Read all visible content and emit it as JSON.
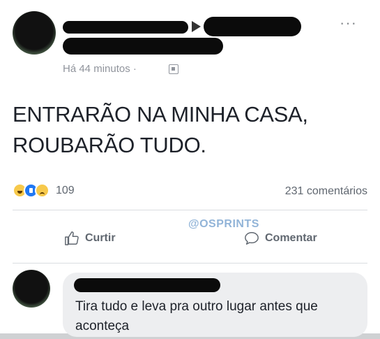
{
  "post": {
    "timestamp": "Há 44 minutos ·",
    "privacy_icon": "group-icon",
    "body": "ENTRARÃO NA MINHA CASA,\nROUBARÃO TUDO.",
    "more_icon": "more-dots-icon",
    "more_label": "···"
  },
  "stats": {
    "reactions": [
      "haha",
      "like",
      "sad"
    ],
    "reaction_count": "109",
    "comment_count": "231 comentários"
  },
  "actions": {
    "like_label": "Curtir",
    "comment_label": "Comentar"
  },
  "watermark": "@OSPRINTS",
  "comment": {
    "text": "Tira tudo e leva pra outro lugar antes que aconteça"
  },
  "colors": {
    "background": "#ffffff",
    "text": "#1d2129",
    "muted": "#606770",
    "bubble": "#edeef0",
    "like_blue": "#2078f4",
    "reaction_yellow": "#f7c94b"
  }
}
